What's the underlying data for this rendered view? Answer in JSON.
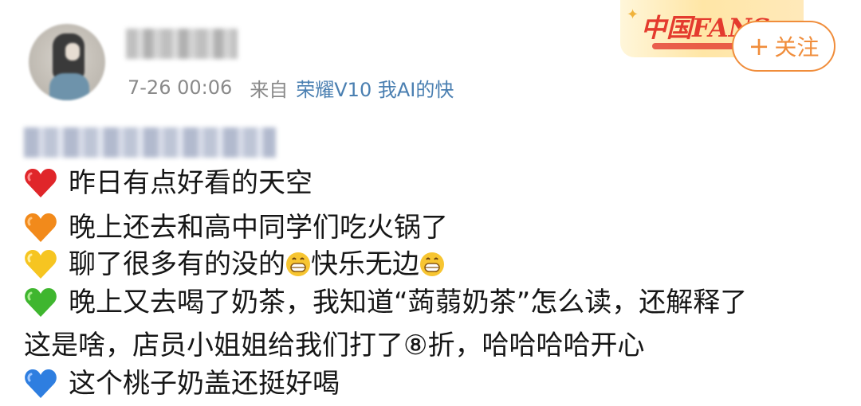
{
  "post": {
    "timestamp": "7-26 00:06",
    "from_label": "来自",
    "source": "荣耀V10 我AI的快"
  },
  "badge": {
    "text": "中国FANS"
  },
  "follow_button": {
    "plus": "+",
    "label": "关注"
  },
  "content": {
    "lines": [
      {
        "icon": "red-heart-icon",
        "color": "#e0262a",
        "text": "昨日有点好看的天空"
      },
      {
        "icon": "orange-heart-icon",
        "color": "#f28a1b",
        "text": "晚上还去和高中同学们吃火锅了"
      },
      {
        "icon": "yellow-heart-icon",
        "color": "#f6c521",
        "text_a": "聊了很多有的没的",
        "text_b": "快乐无边"
      },
      {
        "icon": "green-heart-icon",
        "color": "#3fb62f",
        "text": "晚上又去喝了奶茶，我知道“蒟蒻奶茶”怎么读，还解释了"
      },
      {
        "text": "这是啥，店员小姐姐给我们打了⑧折，哈哈哈哈开心"
      },
      {
        "icon": "blue-heart-icon",
        "color": "#2e7ee0",
        "text": "这个桃子奶盖还挺好喝"
      }
    ]
  }
}
